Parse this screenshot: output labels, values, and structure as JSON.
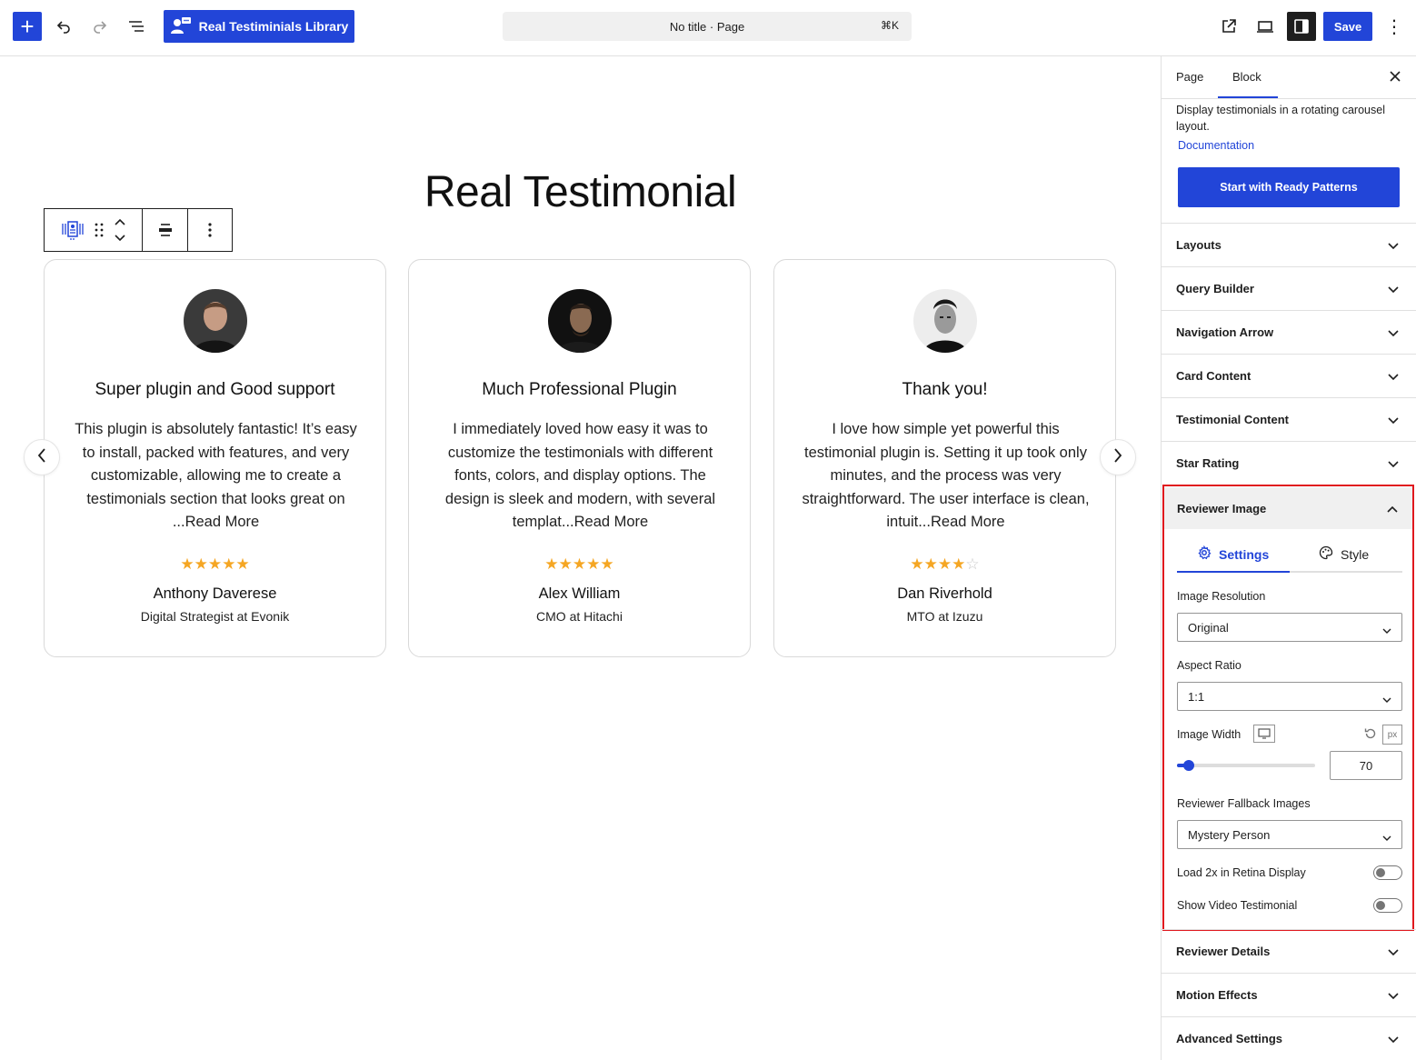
{
  "topbar": {
    "add_label": "+",
    "library_label": "Real Testiminials Library",
    "command_bar_text": "No title · Page",
    "command_shortcut": "⌘K",
    "save_label": "Save",
    "more_label": "⋮"
  },
  "canvas": {
    "heading": "Real Testimonial",
    "cards": [
      {
        "title": "Super plugin and Good support",
        "text": "This plugin is absolutely fantastic! It’s easy to install, packed with features, and very customizable, allowing me to create a testimonials section that looks great on ...Read More",
        "rating": 5,
        "stars": "★★★★★",
        "stars_empty": "",
        "name": "Anthony Daverese",
        "role": "Digital Strategist at Evonik"
      },
      {
        "title": "Much Professional Plugin",
        "text": "I immediately loved how easy it was to customize the testimonials with different fonts, colors, and display options. The design is sleek and modern, with several templat...Read More",
        "rating": 5,
        "stars": "★★★★★",
        "stars_empty": "",
        "name": "Alex William",
        "role": "CMO at Hitachi"
      },
      {
        "title": "Thank you!",
        "text": "I love how simple yet powerful this testimonial plugin is. Setting it up took only minutes, and the process was very straightforward. The user interface is clean, intuit...Read More",
        "rating": 4,
        "stars": "★★★★",
        "stars_empty": "☆",
        "name": "Dan Riverhold",
        "role": "MTO at Izuzu"
      }
    ]
  },
  "sidebar": {
    "tabs": [
      "Page",
      "Block"
    ],
    "close_label": "✕",
    "description": "Display testimonials in a rotating carousel layout.",
    "doc_link": "Documentation",
    "patterns_button": "Start with Ready Patterns",
    "panels_top": [
      "Layouts",
      "Query Builder",
      "Navigation Arrow",
      "Card Content",
      "Testimonial Content",
      "Star Rating"
    ],
    "reviewer_image": {
      "title": "Reviewer Image",
      "sub_tabs": [
        "Settings",
        "Style"
      ],
      "image_resolution_label": "Image Resolution",
      "image_resolution_value": "Original",
      "aspect_ratio_label": "Aspect Ratio",
      "aspect_ratio_value": "1:1",
      "image_width_label": "Image Width",
      "image_width_unit": "px",
      "image_width_value": "70",
      "image_width_slider_fraction": 0.085,
      "fallback_label": "Reviewer Fallback Images",
      "fallback_value": "Mystery Person",
      "retina_label": "Load 2x in Retina Display",
      "retina_on": false,
      "video_label": "Show Video Testimonial",
      "video_on": false
    },
    "panels_bottom": [
      "Reviewer Details",
      "Motion Effects",
      "Advanced Settings"
    ]
  },
  "colors": {
    "accent": "#2245d8",
    "star": "#f5a623",
    "highlight": "#e0181e"
  }
}
